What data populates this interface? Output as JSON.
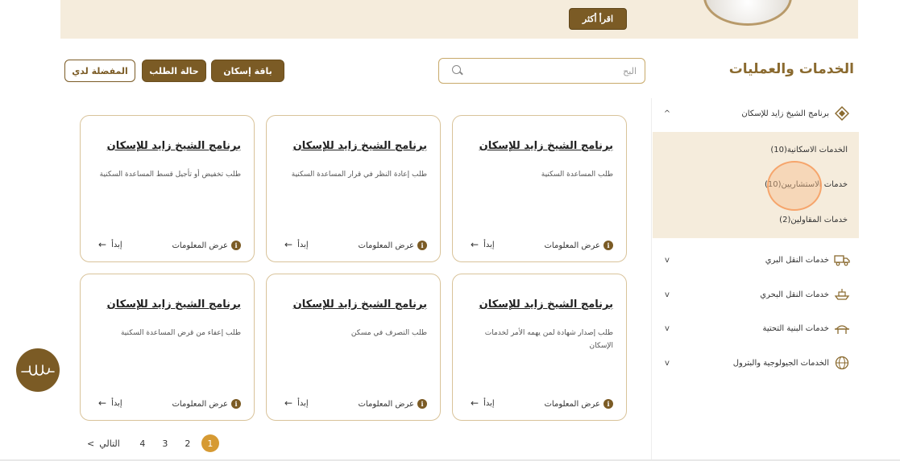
{
  "banner": {
    "read_more_label": "اقرأ أكثر"
  },
  "header": {
    "section_title": "الخدمات والعمليات",
    "search_placeholder": "البح",
    "buttons": {
      "favorites": "المفضلة لدي",
      "request_status": "حالة الطلب",
      "housing_package": "باقة إسكان"
    }
  },
  "sidebar": {
    "items": [
      {
        "label": "برنامج الشيخ زايد للإسكان",
        "icon": "diamond-emblem-icon",
        "chevron": "^"
      },
      {
        "label": "خدمات النقل البري",
        "icon": "truck-icon",
        "chevron": "v"
      },
      {
        "label": "خدمات النقل البحري",
        "icon": "ship-icon",
        "chevron": "v"
      },
      {
        "label": "خدمات البنية التحتية",
        "icon": "bridge-icon",
        "chevron": "v"
      },
      {
        "label": "الخدمات الجيولوجية والبترول",
        "icon": "globe-icon",
        "chevron": "v"
      }
    ],
    "submenu": [
      {
        "label": "الخدمات الاسكانية(10)"
      },
      {
        "label": "خدمات الاستشاريين(10)"
      },
      {
        "label": "خدمات المقاولين(2)"
      }
    ]
  },
  "cards": [
    {
      "title": "برنامج الشيخ زايد للإسكان",
      "desc": "طلب المساعدة السكنية",
      "info": "عرض المعلومات",
      "start": "إبدأ"
    },
    {
      "title": "برنامج الشيخ زايد للإسكان",
      "desc": "طلب إعادة النظر في قرار المساعدة السكنية",
      "info": "عرض المعلومات",
      "start": "إبدأ"
    },
    {
      "title": "برنامج الشيخ زايد للإسكان",
      "desc": "طلب تخفيض أو تأجيل قسط المساعدة السكنية",
      "info": "عرض المعلومات",
      "start": "إبدأ"
    },
    {
      "title": "برنامج الشيخ زايد للإسكان",
      "desc": "طلب إصدار شهادة لمن يهمه الأمر لخدمات الإسكان",
      "info": "عرض المعلومات",
      "start": "إبدأ"
    },
    {
      "title": "برنامج الشيخ زايد للإسكان",
      "desc": "طلب التصرف في مسكن",
      "info": "عرض المعلومات",
      "start": "إبدأ"
    },
    {
      "title": "برنامج الشيخ زايد للإسكان",
      "desc": "طلب إعفاء من قرض المساعدة السكنية",
      "info": "عرض المعلومات",
      "start": "إبدأ"
    }
  ],
  "pagination": {
    "next_label": "التالي",
    "pages": [
      "1",
      "2",
      "3",
      "4"
    ],
    "active": "1"
  },
  "colors": {
    "brand_brown": "#7b5b25",
    "gold": "#d69a33",
    "banner_bg": "#f5ecdc",
    "highlight": "#f5a064"
  }
}
